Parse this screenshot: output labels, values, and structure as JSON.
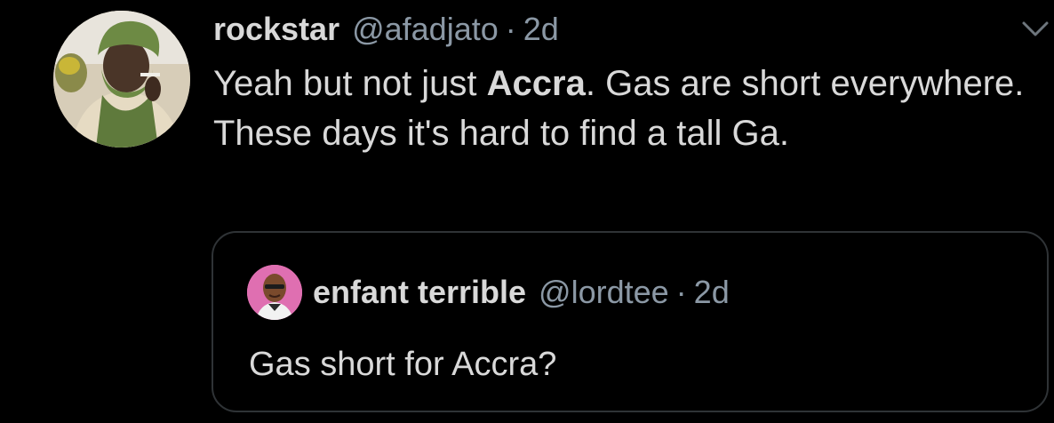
{
  "tweet": {
    "display_name": "rockstar",
    "handle": "@afadjato",
    "separator": "·",
    "time": "2d",
    "text_part1": "Yeah but not just ",
    "text_bold": "Accra",
    "text_part2": ". Gas are short everywhere. These days it's hard to find a tall Ga."
  },
  "quoted_tweet": {
    "display_name": "enfant terrible",
    "handle": "@lordtee",
    "separator": "·",
    "time": "2d",
    "text": "Gas short for Accra?"
  },
  "icons": {
    "caret": "chevron-down-icon",
    "avatar": "avatar",
    "quoted_avatar": "avatar"
  },
  "colors": {
    "background": "#000000",
    "primary_text": "#d9d9d9",
    "secondary_text": "#8b98a5",
    "border": "#2f3336"
  }
}
